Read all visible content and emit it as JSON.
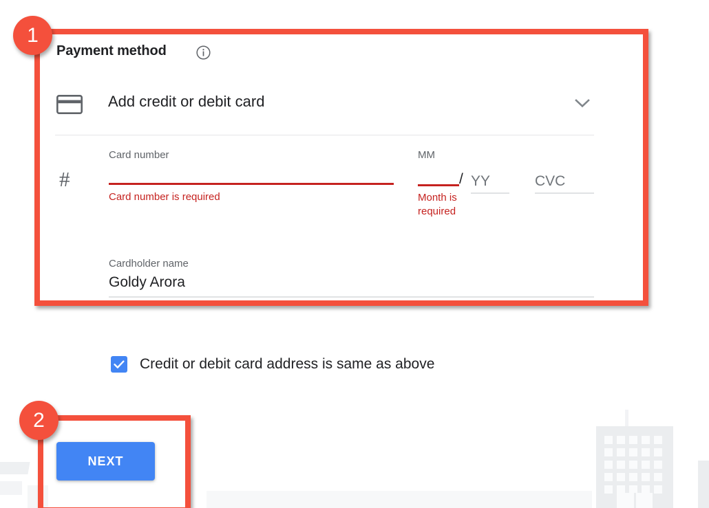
{
  "page": {
    "background_color": "#ffffff"
  },
  "payment_section": {
    "title": "Payment method",
    "info_icon": "info-circle-icon",
    "method": {
      "icon": "credit-card-icon",
      "label": "Add credit or debit card",
      "expand_icon": "chevron-down-icon"
    },
    "fields": {
      "card_number": {
        "row_icon": "hash-icon",
        "label": "Card number",
        "value": "",
        "error": "Card number is required",
        "state": "error"
      },
      "expiry_month": {
        "label": "MM",
        "value": "",
        "error": "Month is required",
        "state": "error"
      },
      "separator": "/",
      "expiry_year": {
        "placeholder": "YY",
        "value": "",
        "state": "normal"
      },
      "cvc": {
        "placeholder": "CVC",
        "value": "",
        "state": "normal"
      },
      "cardholder_name": {
        "label": "Cardholder name",
        "value": "Goldy Arora",
        "state": "normal"
      }
    },
    "billing_checkbox": {
      "label": "Credit or debit card address is same as above",
      "checked": true,
      "icon": "checkmark-icon"
    }
  },
  "actions": {
    "next_label": "NEXT"
  },
  "annotations": {
    "accent_color": "#f4503c",
    "badges": [
      {
        "number": "1",
        "targets": "payment-method-panel"
      },
      {
        "number": "2",
        "targets": "next-button"
      }
    ]
  },
  "colors": {
    "error_red": "#c5221f",
    "primary_blue": "#4285f4",
    "annotation_red": "#f4503c",
    "text_primary": "#202124",
    "text_secondary": "#5f6368"
  }
}
